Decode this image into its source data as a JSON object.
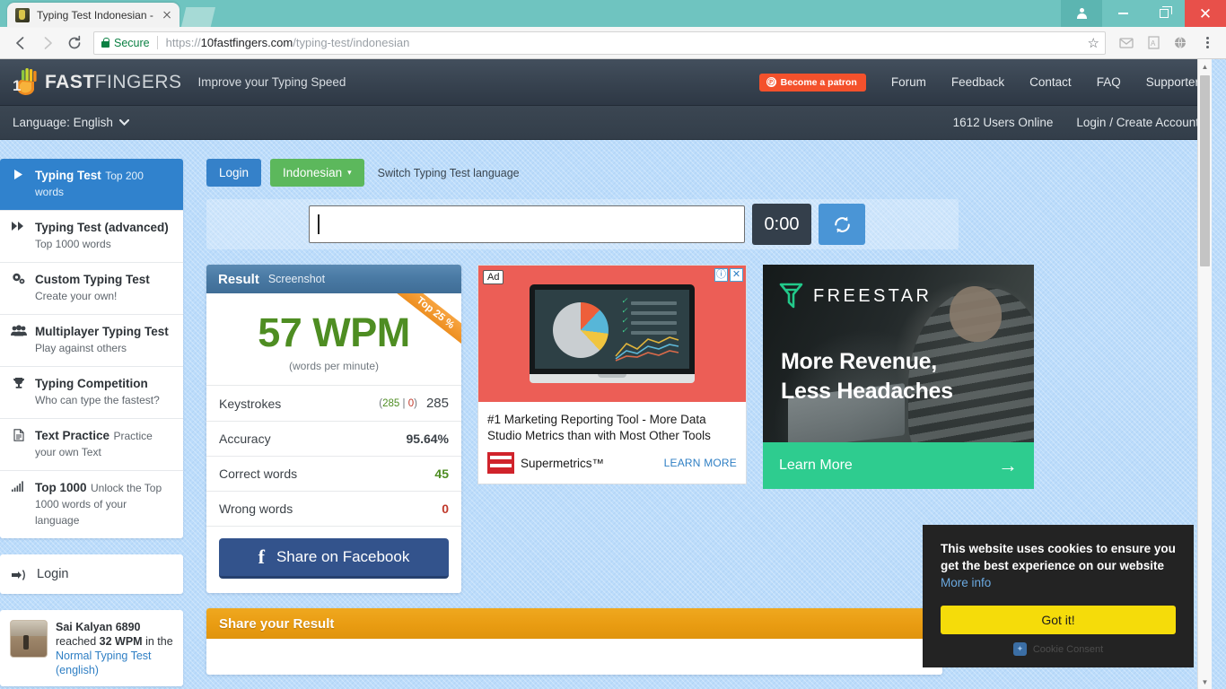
{
  "browser": {
    "tab_title": "Typing Test Indonesian -",
    "secure_label": "Secure",
    "url_domain": "10fastfingers.com",
    "url_scheme": "https://",
    "url_path": "/typing-test/indonesian",
    "back_icon": "←",
    "forward_icon": "→",
    "reload_icon": "⟳",
    "star_icon": "☆",
    "window_close_icon": "✕"
  },
  "header": {
    "logo_text_bold": "FAST",
    "logo_text_thin": "FINGERS",
    "tagline": "Improve your Typing Speed",
    "patron_label": "Become a patron",
    "patron_mark": "Ⓟ",
    "nav": [
      {
        "label": "Forum"
      },
      {
        "label": "Feedback"
      },
      {
        "label": "Contact"
      },
      {
        "label": "FAQ"
      },
      {
        "label": "Supporter"
      }
    ]
  },
  "subheader": {
    "language_label": "Language: English",
    "caret": "❯",
    "users_online": "1612 Users Online",
    "login_create": "Login / Create Account"
  },
  "sidebar": {
    "items": [
      {
        "icon": "▶",
        "title": "Typing Test",
        "sub": "Top 200 words",
        "active": true
      },
      {
        "icon": "▶▶",
        "title": "Typing Test (advanced)",
        "sub": "Top 1000 words",
        "active": false
      },
      {
        "icon": "⚙",
        "title": "Custom Typing Test",
        "sub": "Create your own!",
        "active": false
      },
      {
        "icon": "👥",
        "title": "Multiplayer Typing Test",
        "sub": "Play against others",
        "active": false
      },
      {
        "icon": "🏆",
        "title": "Typing Competition",
        "sub": "Who can type the fastest?",
        "active": false
      },
      {
        "icon": "📄",
        "title": "Text Practice",
        "sub": "Practice your own Text",
        "active": false
      },
      {
        "icon": "📶",
        "title": "Top 1000",
        "sub": "Unlock the Top 1000 words of your language",
        "active": false
      }
    ],
    "login_label": "Login",
    "login_icon": "→]",
    "news": {
      "user": "Sai Kalyan 6890",
      "mid": "reached",
      "wpm": "32 WPM",
      "tail": "in the",
      "link": "Normal Typing",
      "link2": "Test (english)"
    }
  },
  "main": {
    "login_button": "Login",
    "language_button": "Indonesian",
    "language_caret": "▾",
    "switch_note": "Switch Typing Test language",
    "typing_input_value": "",
    "timer": "0:00",
    "reload_icon": "⟳"
  },
  "result": {
    "header_title": "Result",
    "header_tab": "Screenshot",
    "ribbon": "Top 25 %",
    "wpm_value": "57 WPM",
    "wpm_caption": "(words per minute)",
    "rows": [
      {
        "label": "Keystrokes",
        "detail_correct": "285",
        "detail_sep": "|",
        "detail_wrong": "0",
        "value": "285",
        "value_class": "plain"
      },
      {
        "label": "Accuracy",
        "value": "95.64%",
        "value_class": "dark"
      },
      {
        "label": "Correct words",
        "value": "45",
        "value_class": "green"
      },
      {
        "label": "Wrong words",
        "value": "0",
        "value_class": "red"
      }
    ],
    "facebook_button": "Share on Facebook",
    "facebook_glyph": "f"
  },
  "ad_supermetrics": {
    "badge": "Ad",
    "info_icon": "ⓘ",
    "close_icon": "✕",
    "copy": "#1 Marketing Reporting Tool - More Data Studio Metrics than with Most Other Tools",
    "brand": "Supermetrics™",
    "cta": "LEARN MORE"
  },
  "ad_freestar": {
    "brand": "FREESTAR",
    "headline_line1": "More Revenue,",
    "headline_line2": "Less Headaches",
    "cta": "Learn More",
    "cta_arrow": "→"
  },
  "share_panel": {
    "title": "Share your Result"
  },
  "cookie": {
    "text": "This website uses cookies to ensure you get the best experience on our website",
    "more_info": "More info",
    "accept": "Got it!",
    "footer": "Cookie Consent"
  },
  "colors": {
    "page_bg": "#bcdcfb",
    "header_dark": "#3a4653",
    "accent_blue": "#3082cd",
    "green_button": "#5cb85c",
    "wpm_green": "#4e8d22",
    "wrong_red": "#c0392b",
    "orange_ribbon": "#ef9a1e",
    "facebook_blue": "#33538c",
    "cookie_yellow": "#f5dc0a"
  }
}
